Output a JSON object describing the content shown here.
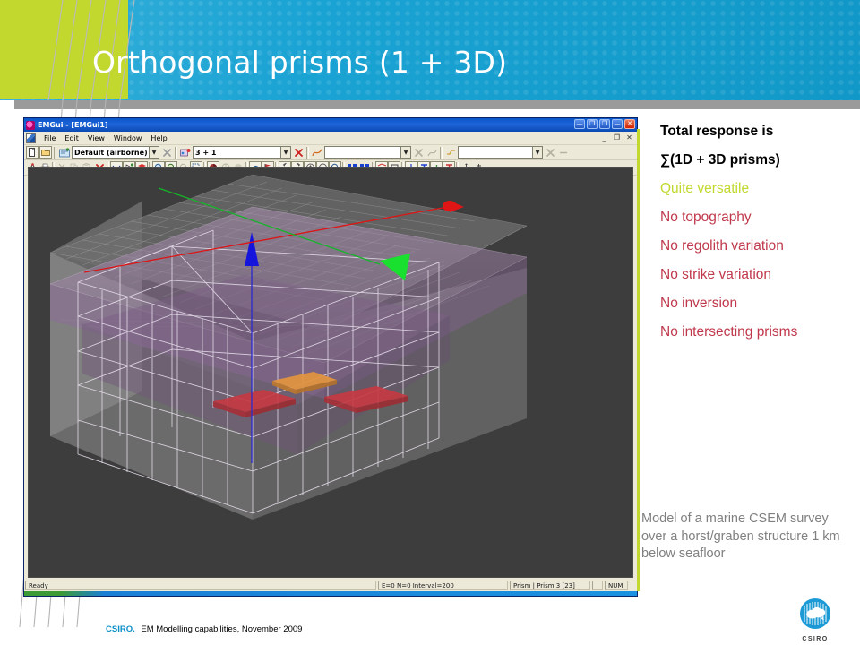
{
  "slide": {
    "title": "Orthogonal prisms (1 + 3D)",
    "header_color": "#12a0d2",
    "accent_green": "#c3d82e"
  },
  "bullets": [
    {
      "text": "Total response is",
      "color": "#000000"
    },
    {
      "text": "∑(1D + 3D prisms)",
      "color": "#000000"
    },
    {
      "text": "Quite versatile",
      "color": "#c3d82e"
    },
    {
      "text": "No topography",
      "color": "#c0384b"
    },
    {
      "text": "No regolith variation",
      "color": "#c0384b"
    },
    {
      "text": "No strike variation",
      "color": "#c0384b"
    },
    {
      "text": "No inversion",
      "color": "#c0384b"
    },
    {
      "text": "No intersecting prisms",
      "color": "#c0384b"
    }
  ],
  "caption": "Model of a marine CSEM survey over a horst/graben structure 1 km below seafloor",
  "app": {
    "title": "EMGui - [EMGui1]",
    "window_buttons": [
      "—",
      "❐",
      "✕"
    ],
    "mdi_buttons": [
      "_",
      "❐",
      "✕"
    ],
    "menus": [
      "File",
      "Edit",
      "View",
      "Window",
      "Help"
    ],
    "toolbar": {
      "system_combo_value": "Default (airborne)",
      "config_combo_value": "3 + 1",
      "curve_combo_value": "",
      "channel_combo_value": "",
      "icons_row1": [
        "new-document-icon",
        "open-folder-icon",
        "system-icon",
        "delete-system-icon",
        "config-icon",
        "delete-config-icon",
        "curve-icon",
        "delete-curve-icon",
        "channel-icon",
        "delete-channel-icon"
      ],
      "icons_row2": [
        "model-tree-icon",
        "print-icon",
        "cut-icon",
        "copy-icon",
        "paste-icon",
        "delete-icon",
        "pan-icon",
        "select-icon",
        "layers-icon",
        "zoom-in-icon",
        "zoom-fit-icon",
        "zoom-out-icon",
        "zoom-region-icon",
        "solid-view-icon",
        "wireframe-view-icon",
        "shaded-view-icon",
        "rotate-icon",
        "flag-icon",
        "undo-rotate-icon",
        "redo-rotate-icon",
        "rotate-up-icon",
        "rotate-down-icon",
        "zoom-extents-icon",
        "grid-icon",
        "grid-snap-icon",
        "prism-icon",
        "box-icon",
        "add-prism-icon",
        "text-tool-icon",
        "add-layer-icon",
        "text-layer-icon",
        "move-icon",
        "scale-icon"
      ]
    },
    "statusbar": {
      "ready": "Ready",
      "coords": "E=0 N=0 Interval=200",
      "selection": "Prism | Prism 3 [23]",
      "num": "NUM"
    },
    "viewport": {
      "background_color": "#3d3d3d",
      "axis_up_color": "#2222dd",
      "axis_east_color": "#dd1111",
      "axis_north_color": "#11bb22",
      "prism_color": "#c83c3c",
      "highlight_prism_color": "#e89a40",
      "seafloor_layer_color": "#a07aa8",
      "mesh_color": "#e8e0ea"
    }
  },
  "footer": {
    "brand": "CSIRO.",
    "text": "EM Modelling capabilities, November 2009",
    "logo_word": "CSIRO"
  }
}
